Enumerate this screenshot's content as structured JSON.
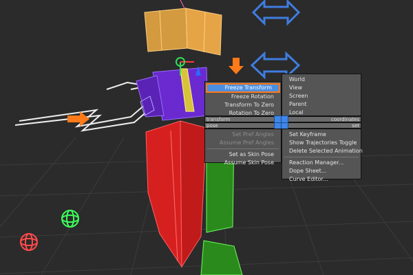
{
  "quad_menu": {
    "transform_title": "transform",
    "coordinates_title": "coordinates",
    "pose_title": "pose",
    "set_title": "set",
    "transform_items": [
      {
        "label": "Freeze Transform",
        "state": "highlighted"
      },
      {
        "label": "Freeze Rotation",
        "state": "enabled"
      },
      {
        "label": "Transform To Zero",
        "state": "enabled"
      },
      {
        "label": "Rotation To Zero",
        "state": "enabled"
      }
    ],
    "coordinates_items": [
      "World",
      "View",
      "Screen",
      "Parent",
      "Local"
    ],
    "pose_items": [
      {
        "label": "Set Pref Angles",
        "state": "disabled"
      },
      {
        "label": "Assume Pref Angles",
        "state": "disabled"
      },
      {
        "label": "Set as Skin Pose",
        "state": "enabled"
      },
      {
        "label": "Assume Skin Pose",
        "state": "enabled"
      }
    ],
    "set_items": [
      "Set Keyframe",
      "Show Trajectories Toggle",
      "Delete Selected Animation",
      "Reaction Manager...",
      "Dope Sheet...",
      "Curve Editor..."
    ]
  },
  "colors": {
    "viewport_bg": "#2b2b2b",
    "menu_bg": "#555555",
    "highlight_bg": "#4b8fe0",
    "highlight_border": "#ff7a18",
    "arrow_orange": "#ff7a18",
    "gizmo_blue": "#3f7de0"
  }
}
